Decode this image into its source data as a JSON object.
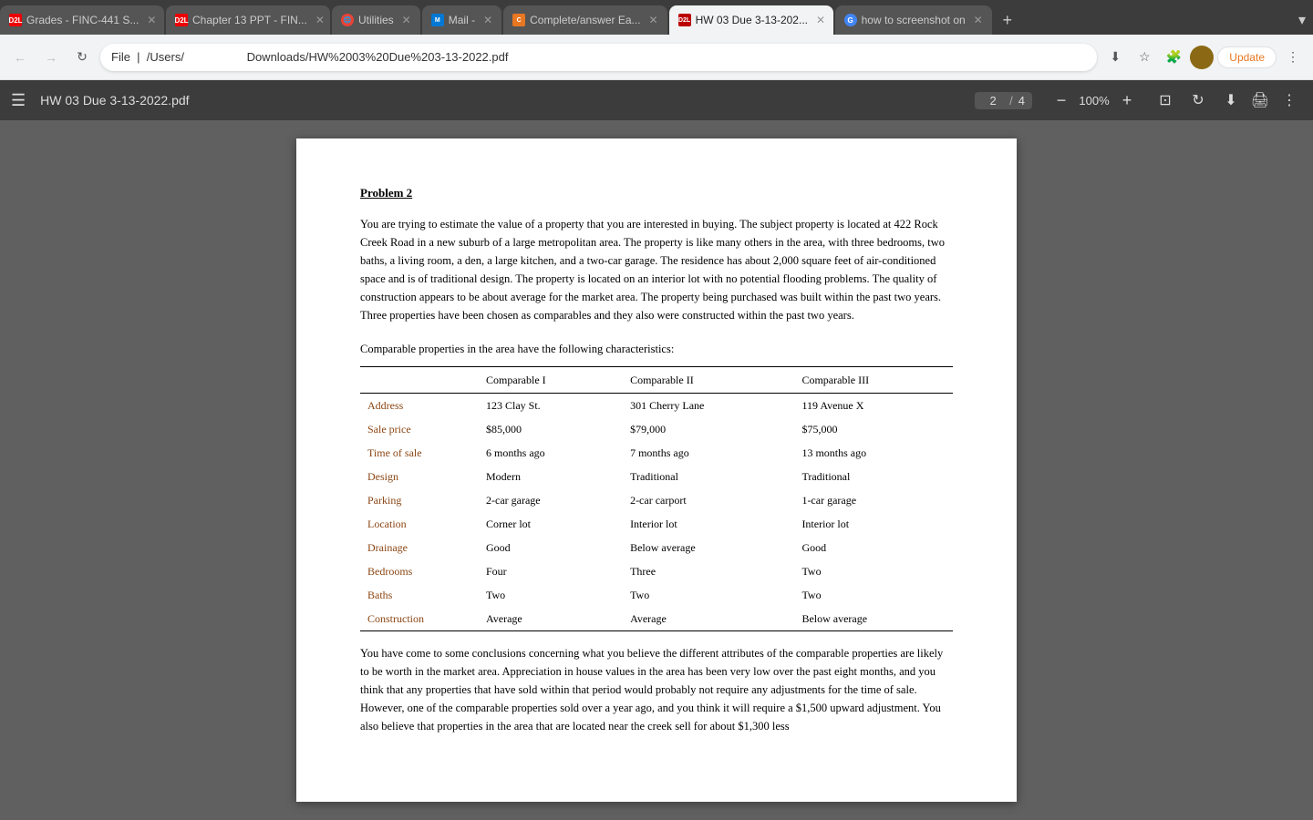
{
  "tabs": [
    {
      "id": "t1",
      "favicon_type": "d2l",
      "label": "Grades - FINC-441 S...",
      "active": false
    },
    {
      "id": "t2",
      "favicon_type": "d2l",
      "label": "Chapter 13 PPT - FIN...",
      "active": false
    },
    {
      "id": "t3",
      "favicon_type": "firefox",
      "label": "Utilities",
      "active": false
    },
    {
      "id": "t4",
      "favicon_type": "outlook",
      "label": "Mail -",
      "active": false
    },
    {
      "id": "t5",
      "favicon_type": "chegg",
      "label": "Complete/answer Ea...",
      "active": false
    },
    {
      "id": "t6",
      "favicon_type": "pdf",
      "label": "HW 03 Due 3-13-202...",
      "active": true
    },
    {
      "id": "t7",
      "favicon_type": "google",
      "label": "how to screenshot on",
      "active": false
    }
  ],
  "address_bar": {
    "url": "File  |  /Users/                   Downloads/HW%2003%20Due%203-13-2022.pdf"
  },
  "toolbar": {
    "filename": "HW 03 Due 3-13-2022.pdf",
    "page_current": "2",
    "page_total": "4",
    "zoom": "100%"
  },
  "pdf": {
    "problem_title": "Problem 2",
    "problem_text": "You are trying to estimate the value of a property that you are interested in buying. The subject property is located at 422 Rock Creek Road in a new suburb of a large metropolitan area. The property is like many others in the area, with three bedrooms, two baths, a living room, a den, a large kitchen, and a two-car garage. The residence has about 2,000 square feet of air-conditioned space and is of traditional design. The property is located on an interior lot with no potential flooding problems. The quality of construction appears to be about average for the market area. The property being purchased was built within the past two years. Three properties have been chosen as comparables and they also were constructed within the past two years.",
    "comparables_intro": "Comparable properties in the area have the following characteristics:",
    "table": {
      "headers": [
        "",
        "Comparable I",
        "Comparable II",
        "Comparable III"
      ],
      "rows": [
        [
          "Address",
          "123 Clay St.",
          "301 Cherry Lane",
          "119 Avenue X"
        ],
        [
          "Sale price",
          "$85,000",
          "$79,000",
          "$75,000"
        ],
        [
          "Time of sale",
          "6 months ago",
          "7 months ago",
          "13 months ago"
        ],
        [
          "Design",
          "Modern",
          "Traditional",
          "Traditional"
        ],
        [
          "Parking",
          "2-car garage",
          "2-car carport",
          "1-car garage"
        ],
        [
          "Location",
          "Corner lot",
          "Interior lot",
          "Interior lot"
        ],
        [
          "Drainage",
          "Good",
          "Below average",
          "Good"
        ],
        [
          "Bedrooms",
          "Four",
          "Three",
          "Two"
        ],
        [
          "Baths",
          "Two",
          "Two",
          "Two"
        ],
        [
          "Construction",
          "Average",
          "Average",
          "Below average"
        ]
      ]
    },
    "bottom_text": "You have come to some conclusions concerning what you believe the different attributes of the comparable properties are likely to be worth in the market area. Appreciation in house values in the area has been very low over the past eight months, and you think that any properties that have sold within that period would probably not require any adjustments for the time of sale. However, one of the comparable properties sold over a year ago, and you think it will require a $1,500 upward adjustment. You also believe that properties in the area that are located near the creek sell for about $1,300 less"
  }
}
